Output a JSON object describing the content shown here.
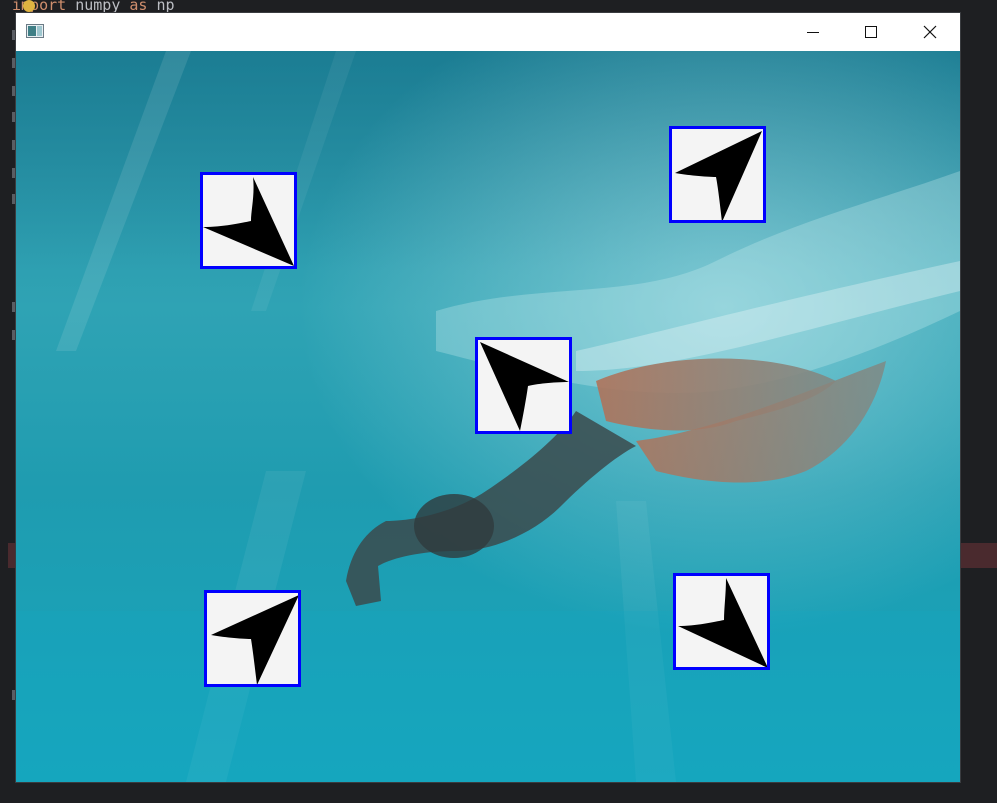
{
  "editor": {
    "line1": {
      "kw1": "import",
      "text1": " numpy ",
      "kw2": "as",
      "text2": " np"
    }
  },
  "window": {
    "title_icon": "image-window-icon",
    "controls": [
      "minimize-icon",
      "maximize-icon",
      "close-icon"
    ]
  },
  "canvas": {
    "scene": "underwater-freediver-photo",
    "markers": [
      {
        "name": "marker-top-left",
        "icon": "arrow-pointer-icon",
        "rotation_deg": 135
      },
      {
        "name": "marker-top-right",
        "icon": "arrow-pointer-icon",
        "rotation_deg": 45
      },
      {
        "name": "marker-center",
        "icon": "arrow-pointer-icon",
        "rotation_deg": 0
      },
      {
        "name": "marker-bottom-left",
        "icon": "arrow-pointer-icon",
        "rotation_deg": 45
      },
      {
        "name": "marker-bottom-right",
        "icon": "arrow-pointer-icon",
        "rotation_deg": 135
      }
    ],
    "colors": {
      "marker_border": "#0000ff",
      "marker_bg": "#f4f4f4",
      "arrow": "#000000"
    }
  }
}
